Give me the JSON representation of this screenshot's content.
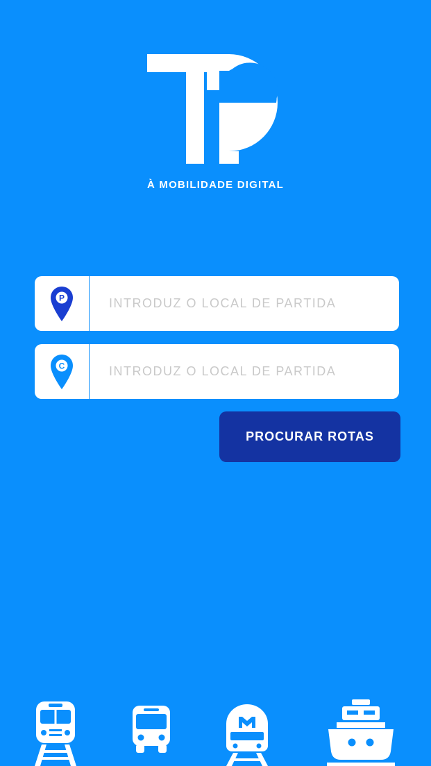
{
  "brand": {
    "logo_text": "TP",
    "tagline": "À MOBILIDADE DIGITAL"
  },
  "route_form": {
    "origin": {
      "pin_letter": "P",
      "placeholder": "INTRODUZ O LOCAL DE PARTIDA",
      "value": ""
    },
    "destination": {
      "pin_letter": "C",
      "placeholder": "INTRODUZ O LOCAL DE PARTIDA",
      "value": ""
    },
    "search_label": "PROCURAR ROTAS"
  },
  "transport_modes": [
    {
      "icon": "train-icon"
    },
    {
      "icon": "bus-icon"
    },
    {
      "icon": "metro-icon"
    },
    {
      "icon": "ferry-icon"
    }
  ],
  "colors": {
    "background": "#0a8ffd",
    "button": "#1433a2",
    "pin": "#1a3ed1",
    "field": "#ffffff"
  }
}
